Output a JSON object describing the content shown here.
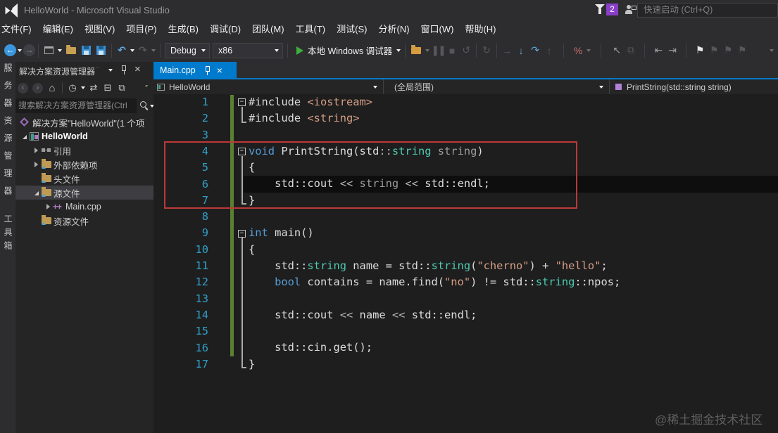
{
  "window": {
    "title": "HelloWorld - Microsoft Visual Studio",
    "quick_launch_placeholder": "快速启动 (Ctrl+Q)",
    "notification_count": "2"
  },
  "menu": {
    "items": [
      "文件(F)",
      "编辑(E)",
      "视图(V)",
      "项目(P)",
      "生成(B)",
      "调试(D)",
      "团队(M)",
      "工具(T)",
      "测试(S)",
      "分析(N)",
      "窗口(W)",
      "帮助(H)"
    ]
  },
  "toolbar": {
    "debug_config": "Debug",
    "platform": "x86",
    "run_label": "本地 Windows 调试器"
  },
  "activity_bar": {
    "tabs": [
      "服务器资源管理器",
      "工具箱"
    ]
  },
  "solution_explorer": {
    "title": "解决方案资源管理器",
    "search_placeholder": "搜索解决方案资源管理器(Ctrl",
    "tree": [
      {
        "label": "解决方案\"HelloWorld\"(1 个项",
        "icon": "solution",
        "arrow": "omit",
        "level": 0,
        "bold": false,
        "selected": false
      },
      {
        "label": "HelloWorld",
        "icon": "project",
        "arrow": "expanded",
        "level": 0,
        "bold": true,
        "selected": false
      },
      {
        "label": "引用",
        "icon": "ref",
        "arrow": "collapsed",
        "level": 1,
        "bold": false,
        "selected": false
      },
      {
        "label": "外部依赖项",
        "icon": "folder",
        "arrow": "collapsed",
        "level": 1,
        "bold": false,
        "selected": false
      },
      {
        "label": "头文件",
        "icon": "folder",
        "arrow": "blank",
        "level": 1,
        "bold": false,
        "selected": false
      },
      {
        "label": "源文件",
        "icon": "folder",
        "arrow": "expanded",
        "level": 1,
        "bold": false,
        "selected": true
      },
      {
        "label": "Main.cpp",
        "icon": "cpp",
        "arrow": "collapsed",
        "level": 2,
        "bold": false,
        "selected": false
      },
      {
        "label": "资源文件",
        "icon": "folder",
        "arrow": "blank",
        "level": 1,
        "bold": false,
        "selected": false
      }
    ]
  },
  "editor": {
    "tab": {
      "label": "Main.cpp"
    },
    "breadcrumb": {
      "project": "HelloWorld",
      "scope": "(全局范围)",
      "member": "PrintString(std::string string)"
    },
    "code": {
      "language": "cpp",
      "current_line": 6,
      "changed_lines_range": [
        1,
        16
      ],
      "outline_boxes": [
        1,
        4,
        9
      ],
      "outline_guides": [
        [
          1,
          2
        ],
        [
          4,
          7
        ],
        [
          9,
          17
        ]
      ],
      "lines": [
        [
          [
            "pre",
            "#include "
          ],
          [
            "s",
            "<iostream>"
          ]
        ],
        [
          [
            "pre",
            "#include "
          ],
          [
            "s",
            "<string>"
          ]
        ],
        [],
        [
          [
            "k",
            "void"
          ],
          [
            "d",
            " PrintString(std"
          ],
          [
            "o",
            "::"
          ],
          [
            "t",
            "string"
          ],
          [
            "p",
            " string"
          ],
          [
            "d",
            ")"
          ]
        ],
        [
          [
            "d",
            "{"
          ]
        ],
        [
          [
            "d",
            "    std::cout "
          ],
          [
            "o",
            "<<"
          ],
          [
            "p",
            " string "
          ],
          [
            "o",
            "<<"
          ],
          [
            "d",
            " std::endl;"
          ]
        ],
        [
          [
            "d",
            "}"
          ]
        ],
        [],
        [
          [
            "k",
            "int"
          ],
          [
            "d",
            " main()"
          ]
        ],
        [
          [
            "d",
            "{"
          ]
        ],
        [
          [
            "d",
            "    std::"
          ],
          [
            "t",
            "string"
          ],
          [
            "d",
            " name = std::"
          ],
          [
            "t",
            "string"
          ],
          [
            "d",
            "("
          ],
          [
            "s",
            "\"cherno\""
          ],
          [
            "d",
            ") + "
          ],
          [
            "s",
            "\"hello\""
          ],
          [
            "d",
            ";"
          ]
        ],
        [
          [
            "d",
            "    "
          ],
          [
            "k",
            "bool"
          ],
          [
            "d",
            " contains = name.find("
          ],
          [
            "s",
            "\"no\""
          ],
          [
            "d",
            ") != std::"
          ],
          [
            "t",
            "string"
          ],
          [
            "d",
            "::npos;"
          ]
        ],
        [],
        [
          [
            "d",
            "    std::cout "
          ],
          [
            "o",
            "<<"
          ],
          [
            "d",
            " name "
          ],
          [
            "o",
            "<<"
          ],
          [
            "d",
            " std::endl;"
          ]
        ],
        [],
        [
          [
            "d",
            "    std::cin.get();"
          ]
        ],
        [
          [
            "d",
            "}"
          ]
        ]
      ]
    }
  },
  "watermark": "@稀土掘金技术社区"
}
